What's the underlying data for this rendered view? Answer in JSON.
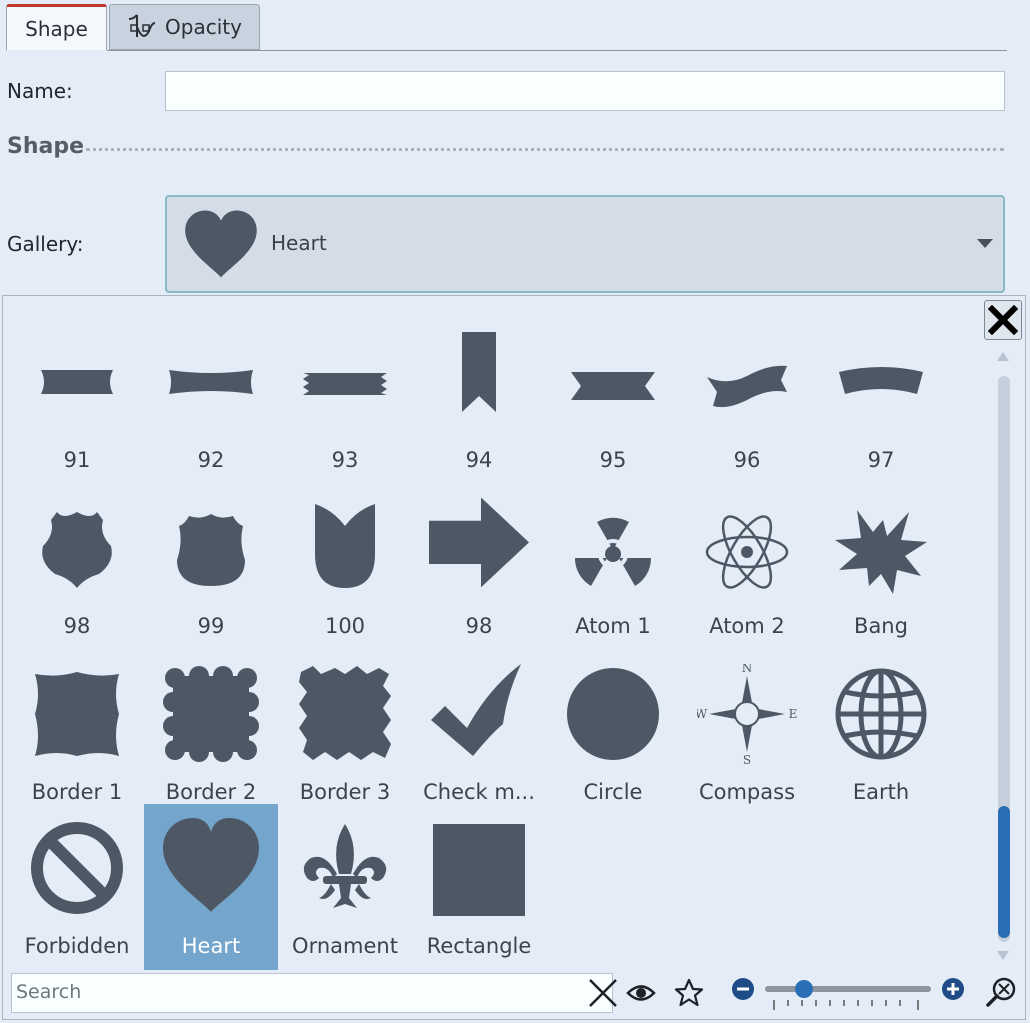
{
  "tabs": [
    {
      "label": "Shape",
      "active": true
    },
    {
      "label": "Opacity",
      "active": false
    }
  ],
  "form": {
    "name_label": "Name:",
    "name_value": "",
    "section_title": "Shape",
    "gallery_label": "Gallery:",
    "gallery_selected": "Heart"
  },
  "gallery": {
    "items": [
      {
        "label": "91",
        "icon": "banner-91-icon"
      },
      {
        "label": "92",
        "icon": "banner-92-icon"
      },
      {
        "label": "93",
        "icon": "banner-93-icon"
      },
      {
        "label": "94",
        "icon": "bookmark-94-icon"
      },
      {
        "label": "95",
        "icon": "ribbon-95-icon"
      },
      {
        "label": "96",
        "icon": "wave-96-icon"
      },
      {
        "label": "97",
        "icon": "arc-banner-97-icon"
      },
      {
        "label": "98",
        "icon": "shield-98-icon"
      },
      {
        "label": "99",
        "icon": "shield-99-icon"
      },
      {
        "label": "100",
        "icon": "shield-100-icon"
      },
      {
        "label": "98",
        "icon": "arrow-right-icon"
      },
      {
        "label": "Atom 1",
        "icon": "radiation-icon"
      },
      {
        "label": "Atom 2",
        "icon": "atom-icon"
      },
      {
        "label": "Bang",
        "icon": "bang-icon"
      },
      {
        "label": "Border 1",
        "icon": "border-1-icon"
      },
      {
        "label": "Border 2",
        "icon": "border-2-icon"
      },
      {
        "label": "Border 3",
        "icon": "border-3-icon"
      },
      {
        "label": "Check m...",
        "icon": "checkmark-icon"
      },
      {
        "label": "Circle",
        "icon": "circle-icon"
      },
      {
        "label": "Compass",
        "icon": "compass-icon"
      },
      {
        "label": "Earth",
        "icon": "globe-icon"
      },
      {
        "label": "Forbidden",
        "icon": "forbidden-icon"
      },
      {
        "label": "Heart",
        "icon": "heart-icon",
        "selected": true
      },
      {
        "label": "Ornament",
        "icon": "fleur-de-lis-icon"
      },
      {
        "label": "Rectangle",
        "icon": "rectangle-icon"
      }
    ]
  },
  "compass_letters": {
    "n": "N",
    "s": "S",
    "e": "E",
    "w": "W"
  },
  "search": {
    "placeholder": "Search",
    "value": ""
  },
  "zoom": {
    "level_fraction": 0.2
  },
  "colors": {
    "shape_fill": "#4e5864",
    "selection": "#74a5cc",
    "accent": "#2a6fb5"
  }
}
